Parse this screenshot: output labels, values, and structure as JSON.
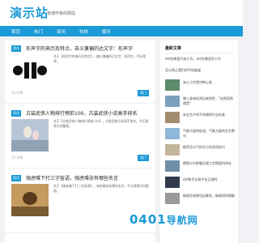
{
  "header": {
    "logo": "演示站",
    "tagline": "普通作家的网站"
  },
  "nav": [
    "首页",
    "热门",
    "资讯",
    "科技",
    "娱乐"
  ],
  "articles": [
    {
      "badge": "资讯",
      "title": "形声字的来历及特点，自义兼偏的达文字：形声字",
      "excerpt": "关于【形声字的来历及特点】，偏义兼偏的达文字，形声字。今天我将...",
      "date": "15-100",
      "tag": "热门"
    },
    {
      "badge": "资讯",
      "title": "古装武侠人物排行榜前100，古装武侠小说高手排名",
      "excerpt": "关于【古装武侠人物排行榜前100】，古装武侠小说高手排名，今天我将为你整理。",
      "date": "15-100",
      "tag": "热门"
    },
    {
      "badge": "资讯",
      "title": "骑虎难下打三字俗语，骑虎难驮有哪些名言",
      "excerpt": "关于【骑虎难下打三字俗语】，骑虎难驮有哪些名言，今天我将为你整理。",
      "date": "",
      "tag": ""
    }
  ],
  "sidebar": {
    "title": "最新文章",
    "items": [
      "dnf在哪里开启小号，dnf在哪里开小号",
      "怎么防止我们的手机被盗",
      "安心工作是何种心态",
      "猪人身体检测出来阳性，\"自然而然就是\"",
      "安全生产的不合格的行业标准",
      "气象方面的俗语，气象方面的名言警句",
      "推荐怎么干好员工的实用技巧",
      "德国卡尔斯鲁厄理工学院国内排名",
      "dnf账号交易平台正规吗",
      "碳税交易税包括哪些，碳税如何理解"
    ]
  },
  "watermark": "0401",
  "watermark_sub": "导航网"
}
